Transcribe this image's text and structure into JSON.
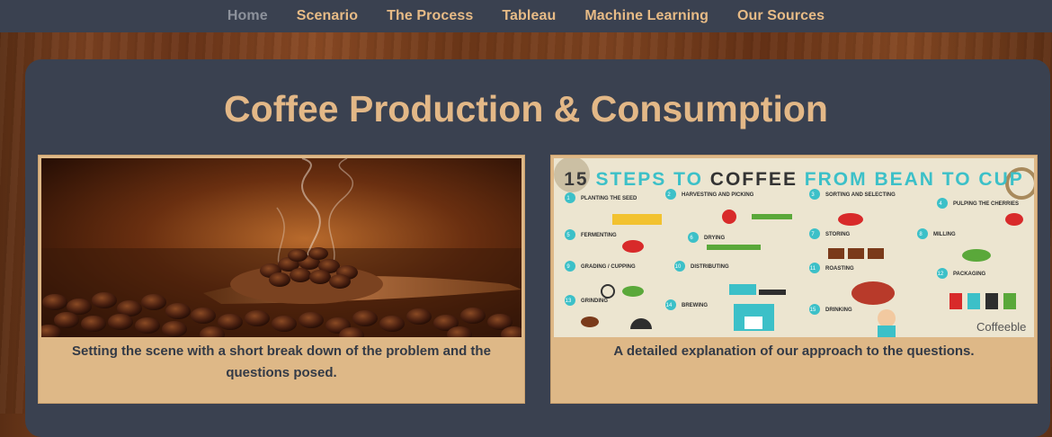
{
  "nav": {
    "items": [
      {
        "label": "Home",
        "active": true
      },
      {
        "label": "Scenario",
        "active": false
      },
      {
        "label": "The Process",
        "active": false
      },
      {
        "label": "Tableau",
        "active": false
      },
      {
        "label": "Machine Learning",
        "active": false
      },
      {
        "label": "Our Sources",
        "active": false
      }
    ]
  },
  "main": {
    "title": "Coffee Production & Consumption"
  },
  "cards": [
    {
      "image": "coffee-beans-spoon-photo",
      "caption": "Setting the scene with a short break down of the problem and the questions posed."
    },
    {
      "image": "coffee-process-infographic",
      "caption": "A detailed explanation of our approach to the questions.",
      "infographic": {
        "number": "15",
        "title_a": "STEPS TO",
        "title_b": "COFFEE",
        "title_c": "FROM BEAN TO CUP",
        "steps": [
          {
            "n": "1",
            "label": "PLANTING THE SEED"
          },
          {
            "n": "2",
            "label": "HARVESTING AND PICKING"
          },
          {
            "n": "3",
            "label": "SORTING AND SELECTING"
          },
          {
            "n": "4",
            "label": "PULPING THE CHERRIES"
          },
          {
            "n": "5",
            "label": "FERMENTING"
          },
          {
            "n": "6",
            "label": "DRYING"
          },
          {
            "n": "7",
            "label": "STORING"
          },
          {
            "n": "8",
            "label": "MILLING"
          },
          {
            "n": "9",
            "label": "GRADING / CUPPING"
          },
          {
            "n": "10",
            "label": "DISTRIBUTING"
          },
          {
            "n": "11",
            "label": "ROASTING"
          },
          {
            "n": "12",
            "label": "PACKAGING"
          },
          {
            "n": "13",
            "label": "GRINDING"
          },
          {
            "n": "14",
            "label": "BREWING"
          },
          {
            "n": "15",
            "label": "DRINKING"
          }
        ],
        "brand": "Coffeeble"
      }
    }
  ],
  "colors": {
    "nav_bg": "#3a4150",
    "accent": "#e3b887",
    "card_bg": "#deb887",
    "active_nav": "#8d929c",
    "infographic_cyan": "#3cc0c8"
  }
}
